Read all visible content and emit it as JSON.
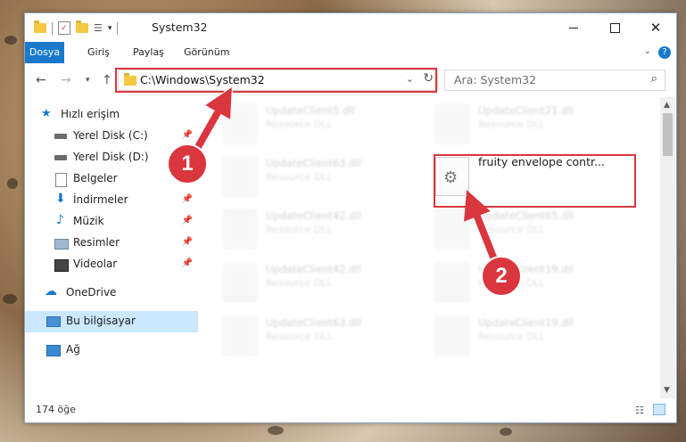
{
  "window": {
    "title": "System32"
  },
  "ribbon": {
    "tabs": [
      "Dosya",
      "Giriş",
      "Paylaş",
      "Görünüm"
    ],
    "help": "?"
  },
  "address": {
    "path": "C:\\Windows\\System32"
  },
  "search": {
    "placeholder": "Ara: System32"
  },
  "sidebar": {
    "items": [
      {
        "label": "Hızlı erişim",
        "icon": "star-icon"
      },
      {
        "label": "Yerel Disk (C:)",
        "icon": "drive-icon"
      },
      {
        "label": "Yerel Disk (D:)",
        "icon": "drive-icon"
      },
      {
        "label": "Belgeler",
        "icon": "documents-icon"
      },
      {
        "label": "İndirmeler",
        "icon": "download-icon"
      },
      {
        "label": "Müzik",
        "icon": "music-icon"
      },
      {
        "label": "Resimler",
        "icon": "pictures-icon"
      },
      {
        "label": "Videolar",
        "icon": "videos-icon"
      },
      {
        "label": "OneDrive",
        "icon": "cloud-icon"
      },
      {
        "label": "Bu bilgisayar",
        "icon": "computer-icon"
      },
      {
        "label": "Ağ",
        "icon": "network-icon"
      }
    ]
  },
  "files": [
    {
      "name": "UpdateClient5.dll",
      "desc": "Resource DLL"
    },
    {
      "name": "UpdateClient21.dll",
      "desc": "Resource DLL"
    },
    {
      "name": "UpdateClient63.dll",
      "desc": "Resource DLL"
    },
    {
      "name": "fruity envelope contr...",
      "desc": ""
    },
    {
      "name": "UpdateClient42.dll",
      "desc": "Resource DLL"
    },
    {
      "name": "UpdateClient65.dll",
      "desc": "Resource DLL"
    },
    {
      "name": "UpdateClient42.dll",
      "desc": "Resource DLL"
    },
    {
      "name": "UpdateClient19.dll",
      "desc": "Resource DLL"
    },
    {
      "name": "UpdateClient63.dll",
      "desc": "Resource DLL"
    },
    {
      "name": "UpdateClient19.dll",
      "desc": "Resource DLL"
    }
  ],
  "status": {
    "count": "174 öğe"
  },
  "annotations": {
    "step1": "1",
    "step2": "2"
  },
  "colors": {
    "accent": "#1979ca",
    "highlight": "#d9363e",
    "selection": "#cce8ff"
  }
}
